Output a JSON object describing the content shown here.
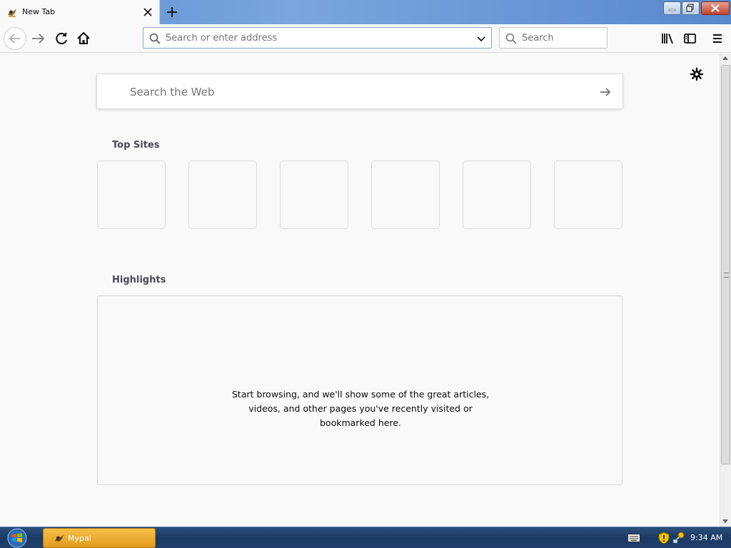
{
  "tab": {
    "title": "New Tab",
    "favicon": "mypal-icon"
  },
  "toolbar": {
    "address_placeholder": "Search or enter address",
    "search_placeholder": "Search"
  },
  "newtab": {
    "web_search_placeholder": "Search the Web",
    "top_sites_title": "Top Sites",
    "top_sites_count": 6,
    "highlights_title": "Highlights",
    "highlights_empty_message": "Start browsing, and we'll show some of the great articles, videos, and other pages you've recently visited or bookmarked here."
  },
  "taskbar": {
    "app_label": "Mypal",
    "clock": "9:34 AM"
  },
  "colors": {
    "accent": "#0a84ff",
    "page_bg": "#f9f9fa",
    "taskbar": "#1b3a64",
    "active_task": "#e9a526"
  }
}
